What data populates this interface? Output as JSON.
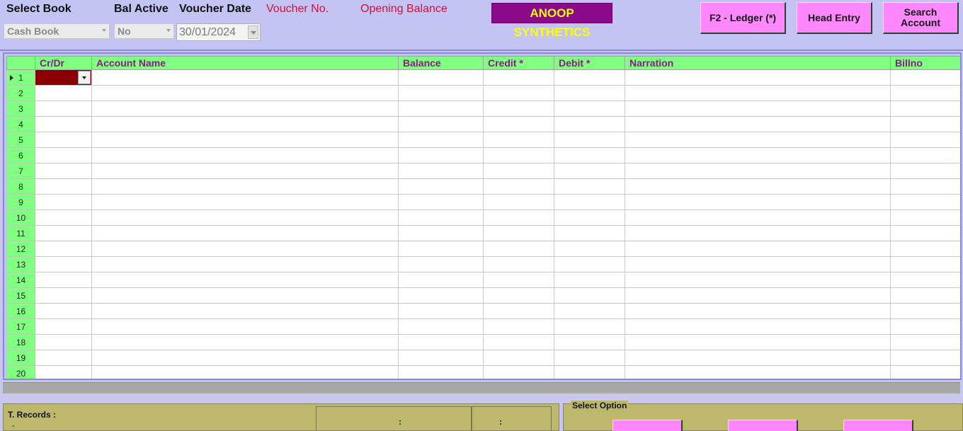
{
  "header": {
    "select_book_label": "Select Book",
    "bal_active_label": "Bal Active",
    "voucher_date_label": "Voucher Date",
    "voucher_no_label": "Voucher No.",
    "opening_balance_label": "Opening Balance",
    "select_book_value": "Cash Book",
    "bal_active_value": "No",
    "voucher_date_value": "30/01/2024",
    "company_name": "ANOOP SYNTHETICS",
    "company_bg": "#8a0a8a",
    "company_fg": "#ffff00"
  },
  "buttons": {
    "ledger": "F2 - Ledger (*)",
    "head_entry": "Head Entry",
    "search_account": "Search Account",
    "color": "#ff88ff"
  },
  "grid": {
    "columns": [
      "Cr/Dr",
      "Account Name",
      "Balance",
      "Credit *",
      "Debit *",
      "Narration",
      "Billno"
    ],
    "rows": [
      "1",
      "2",
      "3",
      "4",
      "5",
      "6",
      "7",
      "8",
      "9",
      "10",
      "11",
      "12",
      "13",
      "14",
      "15",
      "16",
      "17",
      "18",
      "19",
      "20"
    ],
    "header_bg": "#80ff80",
    "header_fg": "#8a1a8a"
  },
  "footer": {
    "t_records_label": "T. Records :",
    "t_records_value": "-",
    "total_sep_1": ":",
    "total_sep_2": ":",
    "select_option_label": "Select Option"
  }
}
